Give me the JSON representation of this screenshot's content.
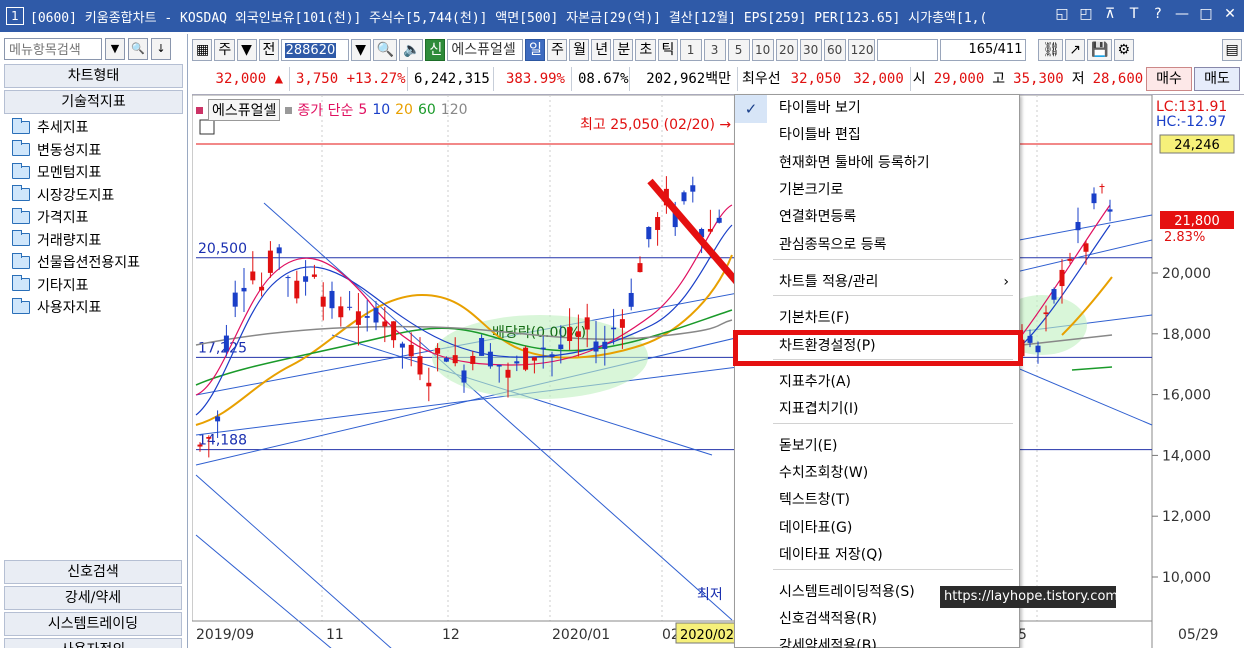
{
  "titlebar": {
    "num": "1",
    "title": "[0600] 키움종합차트 - KOSDAQ 외국인보유[101(천)] 주식수[5,744(천)] 액면[500] 자본금[29(억)] 결산[12월] EPS[259] PER[123.65] 시가총액[1,(",
    "buttons": [
      "◱",
      "◰",
      "⊼",
      "T",
      "?",
      "—",
      "□",
      "✕"
    ]
  },
  "left_panel": {
    "search_placeholder": "메뉴항목검색",
    "header1": "차트형태",
    "header2": "기술적지표",
    "items": [
      "추세지표",
      "변동성지표",
      "모멘텀지표",
      "시장강도지표",
      "가격지표",
      "거래량지표",
      "선물옵션전용지표",
      "기타지표",
      "사용자지표"
    ],
    "bottom": [
      "신호검색",
      "강세/약세",
      "시스템트레이딩",
      "사용자정의"
    ]
  },
  "toolbar": {
    "market": "주",
    "prev": "전",
    "code": "288620",
    "shin": "신",
    "name": "에스퓨얼셀",
    "periods": [
      "일",
      "주",
      "월",
      "년",
      "분",
      "초",
      "틱"
    ],
    "active_period": "일",
    "numbers": [
      "1",
      "3",
      "5",
      "10",
      "20",
      "30",
      "60",
      "120"
    ],
    "count": "165",
    "count_total": "/411"
  },
  "quote": {
    "price": "32,000",
    "arrow": "▲",
    "change": "3,750",
    "pct": "+13.27%",
    "volume": "6,242,315",
    "vol_rate": "383.99%",
    "turnover": "08.67%",
    "amount": "202,962백만",
    "bid_label": "최우선",
    "bid1": "32,050",
    "bid2": "32,000",
    "open_label": "시",
    "open": "29,000",
    "high_label": "고",
    "high": "35,300",
    "low_label": "저",
    "low": "28,600",
    "buy": "매수",
    "sell": "매도"
  },
  "chart": {
    "legend_name": "에스퓨얼셀",
    "legend_ma": "종가 단순",
    "ma_periods": [
      "5",
      "10",
      "20",
      "60",
      "120"
    ],
    "ma_colors": [
      "#e01060",
      "#1a3fc8",
      "#e8a000",
      "#1a9a2a",
      "#888888"
    ],
    "high_note": "최고 25,050 (02/20) →",
    "low_note": "최저",
    "dividend_note": "배당락(0.00%)",
    "left_levels": [
      "20,500",
      "17,225",
      "14,188"
    ],
    "right_top": [
      "LC:131.91",
      "HC:-12.97"
    ],
    "price_box": "24,246",
    "cur_price": "21,800",
    "cur_pct": "2.83%",
    "y_axis": [
      "20,000",
      "18,000",
      "16,000",
      "14,000",
      "12,000",
      "10,000"
    ],
    "x_axis": [
      "2019/09",
      "11",
      "12",
      "2020/01",
      "02",
      "2020/02",
      "5",
      "05/29"
    ]
  },
  "chart_data": {
    "type": "candlestick",
    "title": "에스퓨얼셀",
    "ylim": [
      9500,
      25500
    ],
    "levels": [
      20500,
      17225,
      14188
    ],
    "x_labels": [
      "2019/09",
      "11",
      "12",
      "2020/01",
      "02",
      "05/29"
    ]
  },
  "menu": {
    "items": [
      {
        "label": "타이틀바 보기",
        "checked": true
      },
      {
        "label": "타이틀바 편집"
      },
      {
        "label": "현재화면 툴바에 등록하기"
      },
      {
        "label": "기본크기로"
      },
      {
        "label": "연결화면등록"
      },
      {
        "label": "관심종목으로 등록"
      },
      {
        "label": "차트틀 적용/관리",
        "submenu": true
      },
      {
        "label": "기본차트(F)"
      },
      {
        "label": "차트환경설정(P)",
        "highlight": true
      },
      {
        "label": "지표추가(A)"
      },
      {
        "label": "지표겹치기(I)"
      },
      {
        "label": "돋보기(E)"
      },
      {
        "label": "수치조회창(W)"
      },
      {
        "label": "텍스트창(T)"
      },
      {
        "label": "데이타표(G)"
      },
      {
        "label": "데이타표 저장(Q)"
      },
      {
        "label": "시스템트레이딩적용(S)"
      },
      {
        "label": "신호검색적용(R)"
      },
      {
        "label": "강세약세적용(B)"
      }
    ]
  },
  "watermark": "https://layhope.tistory.com",
  "colors": {
    "title_bg": "#2f5aa8",
    "highlight": "#e51010",
    "arrow": "#e51010"
  }
}
